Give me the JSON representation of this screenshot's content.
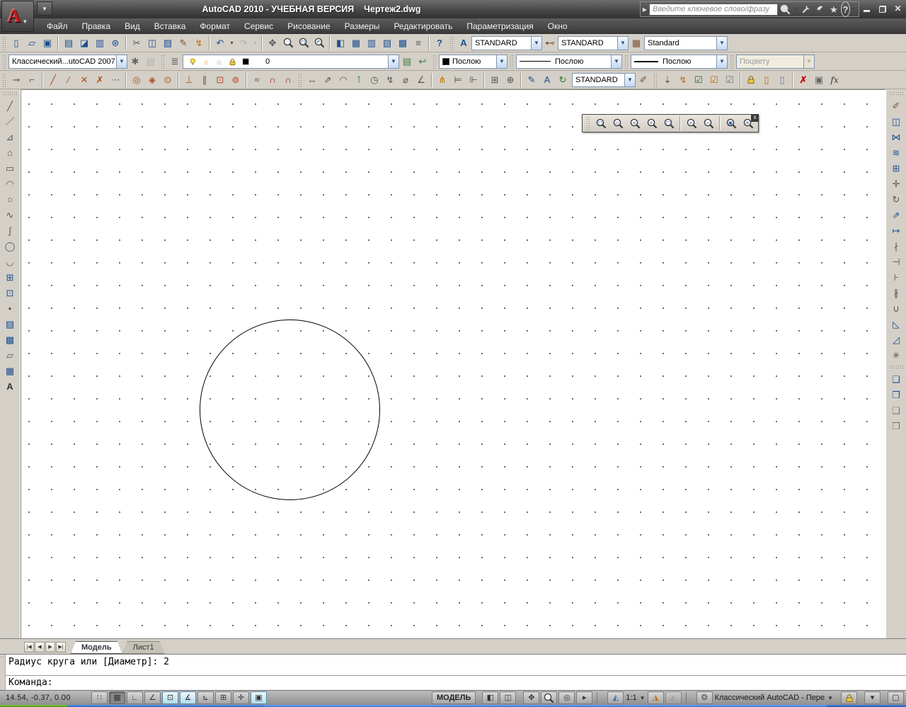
{
  "window": {
    "title": "AutoCAD 2010 - УЧЕБНАЯ ВЕРСИЯ    Чертеж2.dwg"
  },
  "infocenter": {
    "placeholder": "Введите ключевое слово/фразу",
    "icons": [
      {
        "n": "search-icon",
        "svg": "zoom",
        "light": 1
      },
      {
        "n": "search-caret-icon",
        "g": "▾",
        "cls": "tiny"
      },
      {
        "n": "subscription-center-icon",
        "svg": "wrench"
      },
      {
        "n": "communication-center-icon",
        "svg": "dish"
      },
      {
        "n": "favorites-icon",
        "g": "★",
        "c": "#e0e0e0"
      },
      {
        "n": "help-icon",
        "g": "?",
        "cls": "helpcirc"
      },
      {
        "n": "help-caret-icon",
        "g": "▾",
        "cls": "tiny"
      }
    ]
  },
  "menubar": {
    "items": [
      {
        "id": "file",
        "label": "Файл"
      },
      {
        "id": "edit",
        "label": "Правка"
      },
      {
        "id": "view",
        "label": "Вид"
      },
      {
        "id": "insert",
        "label": "Вставка"
      },
      {
        "id": "format",
        "label": "Формат"
      },
      {
        "id": "tools",
        "label": "Сервис"
      },
      {
        "id": "draw",
        "label": "Рисование"
      },
      {
        "id": "dimension",
        "label": "Размеры"
      },
      {
        "id": "modify",
        "label": "Редактировать"
      },
      {
        "id": "parametric",
        "label": "Параметризация"
      },
      {
        "id": "window",
        "label": "Окно"
      }
    ]
  },
  "toolbars": {
    "standard": [
      {
        "n": "qnew-icon",
        "g": "▯"
      },
      {
        "n": "open-icon",
        "g": "▱"
      },
      {
        "n": "save-icon",
        "g": "▣"
      },
      {
        "sep": 1
      },
      {
        "n": "plot-icon",
        "g": "▤"
      },
      {
        "n": "plot-preview-icon",
        "g": "◪"
      },
      {
        "n": "publish-icon",
        "g": "▥"
      },
      {
        "n": "export-3ddwf-icon",
        "g": "⊛"
      },
      {
        "sep": 1
      },
      {
        "n": "cut-icon",
        "g": "✂",
        "c": "#555"
      },
      {
        "n": "copy-icon",
        "g": "◫"
      },
      {
        "n": "paste-icon",
        "g": "▨"
      },
      {
        "n": "match-properties-icon",
        "g": "✎",
        "c": "#7a5230"
      },
      {
        "n": "match-cell-icon",
        "g": "↯",
        "c": "#c07000"
      },
      {
        "sep": 1
      },
      {
        "n": "undo-icon",
        "g": "↶"
      },
      {
        "n": "undo-caret-icon",
        "g": "▾",
        "cls": "tiny"
      },
      {
        "n": "redo-icon",
        "g": "↷",
        "state": "disabled"
      },
      {
        "n": "redo-caret-icon",
        "g": "▾",
        "cls": "tiny",
        "state": "disabled"
      },
      {
        "sep": 1
      },
      {
        "n": "pan-icon",
        "g": "✥",
        "c": "#555"
      },
      {
        "n": "zoom-realtime-icon",
        "svg": "zoom"
      },
      {
        "n": "zoom-window-icon",
        "svg": "zoom",
        "inner": "□"
      },
      {
        "n": "zoom-previous-icon",
        "svg": "zoom",
        "inner": "↶"
      },
      {
        "sep": 1
      },
      {
        "n": "properties-palette-icon",
        "g": "◧"
      },
      {
        "n": "designcenter-icon",
        "g": "▦"
      },
      {
        "n": "tool-palettes-icon",
        "g": "▥"
      },
      {
        "n": "sheetset-manager-icon",
        "g": "▧"
      },
      {
        "n": "markup-manager-icon",
        "g": "▩"
      },
      {
        "n": "quickcalc-icon",
        "g": "≡",
        "c": "#555"
      },
      {
        "sep": 1
      },
      {
        "n": "help-icon",
        "g": "?",
        "cls": "bold",
        "c": "#1d4f91"
      }
    ],
    "styles": {
      "text_style_icon": {
        "n": "text-style-icon",
        "g": "A",
        "cls": "bold"
      },
      "dim_style_icon": {
        "n": "dim-style-icon",
        "g": "⊷",
        "c": "#7a5230"
      },
      "table_style_icon": {
        "n": "table-style-icon",
        "g": "▦",
        "c": "#7a5230"
      },
      "text_style": "STANDARD",
      "dim_style": "STANDARD",
      "table_style": "Standard"
    },
    "workspace_value": "Классический...utoCAD 2007",
    "workspace_icons": [
      {
        "n": "workspace-settings-icon",
        "g": "✱",
        "c": "#666"
      },
      {
        "n": "my-workspace-icon",
        "g": "▧",
        "state": "disabled"
      }
    ],
    "layer": {
      "manager_icon": {
        "n": "layer-properties-manager-icon",
        "g": "≣",
        "c": "#555"
      },
      "combo_icons": [
        {
          "n": "layer-on-bulb-icon",
          "svg": "bulb"
        },
        {
          "n": "layer-thaw-sun-icon",
          "g": "☼",
          "c": "#e8a000"
        },
        {
          "n": "layer-vp-freeze-icon",
          "g": "☼",
          "c": "#9a9a9a"
        },
        {
          "n": "layer-lock-icon",
          "svg": "lock"
        },
        {
          "n": "layer-color-swatch",
          "svg": "swatch",
          "c": "#000000"
        }
      ],
      "current": "0",
      "after_icons": [
        {
          "n": "layer-states-manager-icon",
          "g": "▤",
          "c": "#3f7a3f"
        },
        {
          "n": "layer-previous-icon",
          "g": "↩",
          "c": "#3f7a3f"
        }
      ]
    },
    "properties": {
      "color": "Послою",
      "linetype": "Послою",
      "lineweight": "Послою",
      "plot_style": "Поцвету"
    },
    "osnap": [
      {
        "n": "temporary-track-point-icon",
        "g": "⊸",
        "c": "#555"
      },
      {
        "n": "snap-from-icon",
        "g": "⌐",
        "c": "#555"
      },
      {
        "sep": 1
      },
      {
        "n": "snap-endpoint-icon",
        "g": "╱",
        "c": "#b24a1a"
      },
      {
        "n": "snap-midpoint-icon",
        "g": "∕",
        "c": "#b24a1a"
      },
      {
        "n": "snap-intersection-icon",
        "g": "✕",
        "c": "#b24a1a"
      },
      {
        "n": "snap-apparent-intersection-icon",
        "g": "✗",
        "c": "#b24a1a"
      },
      {
        "n": "snap-extension-icon",
        "g": "⋯",
        "c": "#555"
      },
      {
        "sep": 1
      },
      {
        "n": "snap-center-icon",
        "g": "◎",
        "c": "#b24a1a"
      },
      {
        "n": "snap-quadrant-icon",
        "g": "◈",
        "c": "#b24a1a"
      },
      {
        "n": "snap-tangent-icon",
        "g": "⊙",
        "c": "#b24a1a"
      },
      {
        "sep": 1
      },
      {
        "n": "snap-perpendicular-icon",
        "g": "⊥",
        "c": "#b24a1a"
      },
      {
        "n": "snap-parallel-icon",
        "g": "∥",
        "c": "#555"
      },
      {
        "n": "snap-insertion-icon",
        "g": "⊡",
        "c": "#b24a1a"
      },
      {
        "n": "snap-node-icon",
        "g": "⊚",
        "c": "#b24a1a"
      },
      {
        "sep": 1
      },
      {
        "n": "snap-nearest-icon",
        "g": "≈",
        "c": "#555"
      },
      {
        "n": "snap-none-icon",
        "g": "∩",
        "c": "#b22222",
        "cls": "bold"
      },
      {
        "n": "osnap-settings-icon",
        "g": "∩",
        "c": "#8a2b2b",
        "cls": "bold"
      }
    ],
    "dimension": {
      "icons": [
        {
          "n": "dim-linear-icon",
          "g": "↔",
          "c": "#555"
        },
        {
          "n": "dim-aligned-icon",
          "g": "⇗",
          "c": "#555"
        },
        {
          "n": "dim-arc-length-icon",
          "g": "◠",
          "c": "#555"
        },
        {
          "n": "dim-ordinate-icon",
          "g": "⊺",
          "c": "#2a7a2a"
        },
        {
          "n": "dim-radius-icon",
          "g": "◷",
          "c": "#555"
        },
        {
          "n": "dim-jogged-icon",
          "g": "↯",
          "c": "#555"
        },
        {
          "n": "dim-diameter-icon",
          "g": "⌀",
          "c": "#555"
        },
        {
          "n": "dim-angular-icon",
          "g": "∠",
          "c": "#555"
        },
        {
          "sep": 1
        },
        {
          "n": "quick-dimension-icon",
          "g": "⋔",
          "c": "#c07000"
        },
        {
          "n": "dim-baseline-icon",
          "g": "⊨",
          "c": "#555"
        },
        {
          "n": "dim-continue-icon",
          "g": "⊩",
          "c": "#555"
        },
        {
          "sep": 1
        },
        {
          "n": "tolerance-icon",
          "g": "⊞",
          "c": "#555"
        },
        {
          "n": "center-mark-icon",
          "g": "⊕",
          "c": "#555"
        },
        {
          "sep": 1
        },
        {
          "n": "dim-edit-icon",
          "g": "✎",
          "c": "#1d4f91"
        },
        {
          "n": "dim-text-edit-icon",
          "g": "A",
          "c": "#1d4f91"
        },
        {
          "n": "dim-update-icon",
          "g": "↻",
          "c": "#2a7a2a"
        }
      ],
      "style": "STANDARD",
      "apply_icon": {
        "n": "dim-style-apply-icon",
        "g": "✐",
        "c": "#7a5230"
      }
    },
    "parametric": [
      {
        "n": "infer-constraints-icon",
        "g": "⇣",
        "c": "#555"
      },
      {
        "n": "auto-constrain-icon",
        "g": "↯",
        "c": "#c07000"
      },
      {
        "n": "geometric-constraint-icon",
        "g": "☑",
        "c": "#2a6a2a"
      },
      {
        "n": "show-constraints-icon",
        "g": "☑",
        "c": "#c07000"
      },
      {
        "n": "show-all-constraints-icon",
        "g": "☑",
        "c": "#777"
      },
      {
        "sep": 1
      },
      {
        "n": "constraint-lock-icon",
        "svg": "lock"
      },
      {
        "n": "dimensional-constraint-icon",
        "g": "▯",
        "c": "#c07000"
      },
      {
        "n": "show-dynamic-constraints-icon",
        "g": "▯",
        "c": "#777"
      },
      {
        "sep": 1
      },
      {
        "n": "delete-constraints-icon",
        "g": "✗",
        "c": "#c00000",
        "cls": "bold"
      },
      {
        "n": "constraint-settings-icon",
        "g": "▣",
        "c": "#666"
      },
      {
        "n": "parameters-manager-icon",
        "g": "fx",
        "cls": "fx"
      }
    ],
    "draw": [
      {
        "n": "line-icon",
        "g": "╱",
        "c": "#555"
      },
      {
        "n": "construction-line-icon",
        "g": "／",
        "c": "#555"
      },
      {
        "n": "polyline-icon",
        "g": "⊿",
        "c": "#555"
      },
      {
        "n": "polygon-icon",
        "g": "⌂",
        "c": "#555"
      },
      {
        "n": "rectangle-icon",
        "g": "▭",
        "c": "#555"
      },
      {
        "n": "arc-icon",
        "g": "◠",
        "c": "#555"
      },
      {
        "n": "circle-icon",
        "g": "○",
        "c": "#555"
      },
      {
        "n": "revcloud-icon",
        "g": "∿",
        "c": "#555"
      },
      {
        "n": "spline-icon",
        "g": "∫",
        "c": "#555"
      },
      {
        "n": "ellipse-icon",
        "g": "◯",
        "c": "#555"
      },
      {
        "n": "ellipse-arc-icon",
        "g": "◡",
        "c": "#555"
      },
      {
        "n": "insert-block-icon",
        "g": "⊞",
        "c": "#1d4f91"
      },
      {
        "n": "make-block-icon",
        "g": "⊡",
        "c": "#1d4f91"
      },
      {
        "n": "point-icon",
        "g": "•",
        "c": "#555"
      },
      {
        "n": "hatch-icon",
        "g": "▨",
        "c": "#1d4f91"
      },
      {
        "n": "gradient-icon",
        "g": "▩",
        "c": "#1d4f91"
      },
      {
        "n": "region-icon",
        "g": "▱",
        "c": "#555"
      },
      {
        "n": "table-icon",
        "g": "▦",
        "c": "#1d4f91"
      },
      {
        "n": "mtext-icon",
        "g": "A",
        "cls": "bold",
        "c": "#333"
      }
    ],
    "modify": [
      {
        "n": "erase-icon",
        "g": "✐",
        "c": "#8a5a2a"
      },
      {
        "n": "copy-icon",
        "g": "◫",
        "c": "#1d4f91"
      },
      {
        "n": "mirror-icon",
        "g": "⋈",
        "c": "#1d4f91"
      },
      {
        "n": "offset-icon",
        "g": "≋",
        "c": "#1d4f91"
      },
      {
        "n": "array-icon",
        "g": "⊞",
        "c": "#1d4f91"
      },
      {
        "n": "move-icon",
        "g": "✛",
        "c": "#555"
      },
      {
        "n": "rotate-icon",
        "g": "↻",
        "c": "#555"
      },
      {
        "n": "scale-icon",
        "g": "⇗",
        "c": "#1d4f91"
      },
      {
        "n": "stretch-icon",
        "g": "↦",
        "c": "#1d4f91"
      },
      {
        "n": "trim-icon",
        "g": "∤",
        "c": "#555"
      },
      {
        "n": "extend-icon",
        "g": "⊣",
        "c": "#555"
      },
      {
        "n": "break-at-point-icon",
        "g": "⊦",
        "c": "#555"
      },
      {
        "n": "break-icon",
        "g": "∦",
        "c": "#555"
      },
      {
        "n": "join-icon",
        "g": "∪",
        "c": "#555"
      },
      {
        "n": "chamfer-icon",
        "g": "◺",
        "c": "#1d4f91"
      },
      {
        "n": "fillet-icon",
        "g": "◿",
        "c": "#1d4f91"
      },
      {
        "n": "explode-icon",
        "g": "✳",
        "c": "#555"
      }
    ],
    "draworder": [
      {
        "n": "bring-to-front-icon",
        "g": "❑",
        "c": "#1d4f91"
      },
      {
        "n": "send-to-back-icon",
        "g": "❒",
        "c": "#1d4f91"
      },
      {
        "n": "bring-above-objects-icon",
        "g": "❑",
        "c": "#777"
      },
      {
        "n": "send-under-objects-icon",
        "g": "❒",
        "c": "#777"
      }
    ]
  },
  "zoom_toolbar": [
    {
      "n": "zoom-window-icon",
      "svg": "zoom",
      "inner": "□"
    },
    {
      "n": "zoom-dynamic-icon",
      "svg": "zoom",
      "inner": "◇"
    },
    {
      "n": "zoom-scale-icon",
      "svg": "zoom",
      "inner": "×"
    },
    {
      "n": "zoom-center-icon",
      "svg": "zoom",
      "inner": "+"
    },
    {
      "n": "zoom-object-icon",
      "svg": "zoom",
      "inner": "▢"
    },
    {
      "sep": 1
    },
    {
      "n": "zoom-in-icon",
      "svg": "zoom",
      "inner": "+"
    },
    {
      "n": "zoom-out-icon",
      "svg": "zoom",
      "inner": "−"
    },
    {
      "sep": 1
    },
    {
      "n": "zoom-all-icon",
      "svg": "zoom",
      "inner": "▣"
    },
    {
      "n": "zoom-extents-icon",
      "svg": "zoom",
      "inner": "✳"
    }
  ],
  "canvas": {
    "entities": [
      "circle"
    ]
  },
  "layout_tabs": {
    "nav": [
      {
        "n": "first-tab-icon",
        "g": "|◀"
      },
      {
        "n": "prev-tab-icon",
        "g": "◀"
      },
      {
        "n": "next-tab-icon",
        "g": "▶"
      },
      {
        "n": "last-tab-icon",
        "g": "▶|"
      }
    ],
    "model": "Модель",
    "layout1": "Лист1"
  },
  "command_line": {
    "history": "Радиус круга или [Диаметр]: 2",
    "prompt": "Команда:"
  },
  "status_bar": {
    "coordinates": "14.54, -0.37, 0.00",
    "toggles": [
      {
        "n": "snap-toggle",
        "g": "∷",
        "state": "off"
      },
      {
        "n": "grid-toggle",
        "g": "▦",
        "state": "on-dark"
      },
      {
        "n": "ortho-toggle",
        "g": "∟",
        "state": "off"
      },
      {
        "n": "polar-toggle",
        "g": "∠",
        "state": "off"
      },
      {
        "n": "osnap-toggle",
        "g": "⊡",
        "state": "on"
      },
      {
        "n": "otrack-toggle",
        "g": "∡",
        "state": "on"
      },
      {
        "n": "ducs-toggle",
        "g": "⊾",
        "state": "off"
      },
      {
        "n": "dyn-toggle",
        "g": "⊞",
        "state": "off"
      },
      {
        "n": "lwt-toggle",
        "g": "✛",
        "state": "off"
      },
      {
        "n": "quick-properties-toggle",
        "g": "▣",
        "state": "on"
      }
    ],
    "model_button": "МОДЕЛЬ",
    "quickview_icons": [
      {
        "n": "quickview-layouts-icon",
        "g": "◧",
        "c": "#333"
      },
      {
        "n": "quickview-drawings-icon",
        "g": "◫",
        "c": "#333"
      }
    ],
    "nav_icons": [
      {
        "n": "pan-icon",
        "g": "✥",
        "c": "#333"
      },
      {
        "n": "zoom-icon",
        "svg": "zoom"
      },
      {
        "n": "steering-wheel-icon",
        "g": "◎",
        "c": "#333"
      },
      {
        "n": "show-motion-icon",
        "g": "▸",
        "c": "#333"
      }
    ],
    "annotation_scale": "1:1",
    "annotation_icons_left": [
      {
        "n": "annotation-scale-icon",
        "g": "◭",
        "c": "#3a6ea5"
      }
    ],
    "annotation_icons_right": [
      {
        "n": "annotation-visibility-icon",
        "g": "◮",
        "c": "#c07000"
      },
      {
        "n": "auto-annotate-icon",
        "g": "◭",
        "state": "disabled"
      }
    ],
    "workspace_gear_icon": [
      {
        "n": "workspace-gear-icon",
        "g": "❂",
        "c": "#555"
      }
    ],
    "workspace_label": "Классический AutoCAD - Пере",
    "lock_icon": [
      {
        "n": "ui-lock-icon",
        "svg": "lock"
      }
    ],
    "tray_caret_icon": [
      {
        "n": "tray-caret-icon",
        "g": "▾",
        "c": "#333"
      }
    ],
    "cleanscreen_icon": [
      {
        "n": "clean-screen-icon",
        "g": "▢",
        "c": "#333"
      }
    ]
  }
}
